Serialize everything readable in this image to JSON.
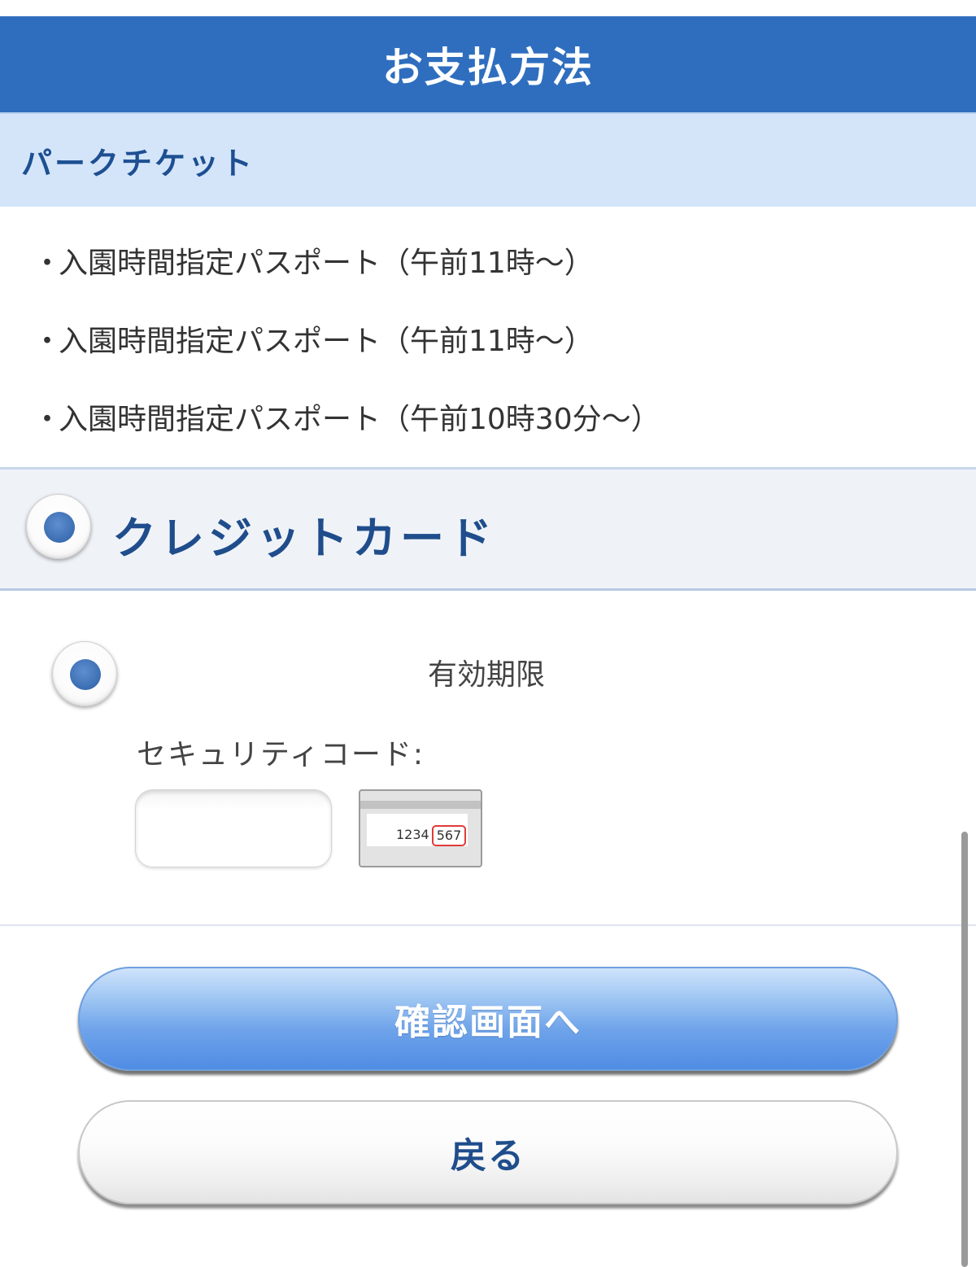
{
  "header": {
    "title": "お支払方法"
  },
  "section": {
    "title": "パークチケット"
  },
  "tickets": [
    {
      "bullet": "・",
      "label": "入園時間指定パスポート（午前11時〜）"
    },
    {
      "bullet": "・",
      "label": "入園時間指定パスポート（午前11時〜）"
    },
    {
      "bullet": "・",
      "label": "入園時間指定パスポート（午前10時30分〜）"
    }
  ],
  "payment": {
    "method_label": "クレジットカード",
    "expiry_label": "有効期限",
    "security_code_label": "セキュリティコード:",
    "security_code_value": "",
    "card_sample": {
      "number": "1234",
      "cvc": "567"
    }
  },
  "buttons": {
    "confirm_label": "確認画面へ",
    "back_label": "戻る"
  },
  "colors": {
    "header_bg": "#2f6ebf",
    "section_bg": "#d4e5fa",
    "accent_text": "#1f4d8c",
    "radio_dot": "#3b6db2",
    "cvc_highlight": "#e23a3a"
  },
  "icons": {
    "method_radio": "radio-selected-icon",
    "card_radio": "radio-selected-icon",
    "card_sample": "credit-card-back-icon"
  }
}
